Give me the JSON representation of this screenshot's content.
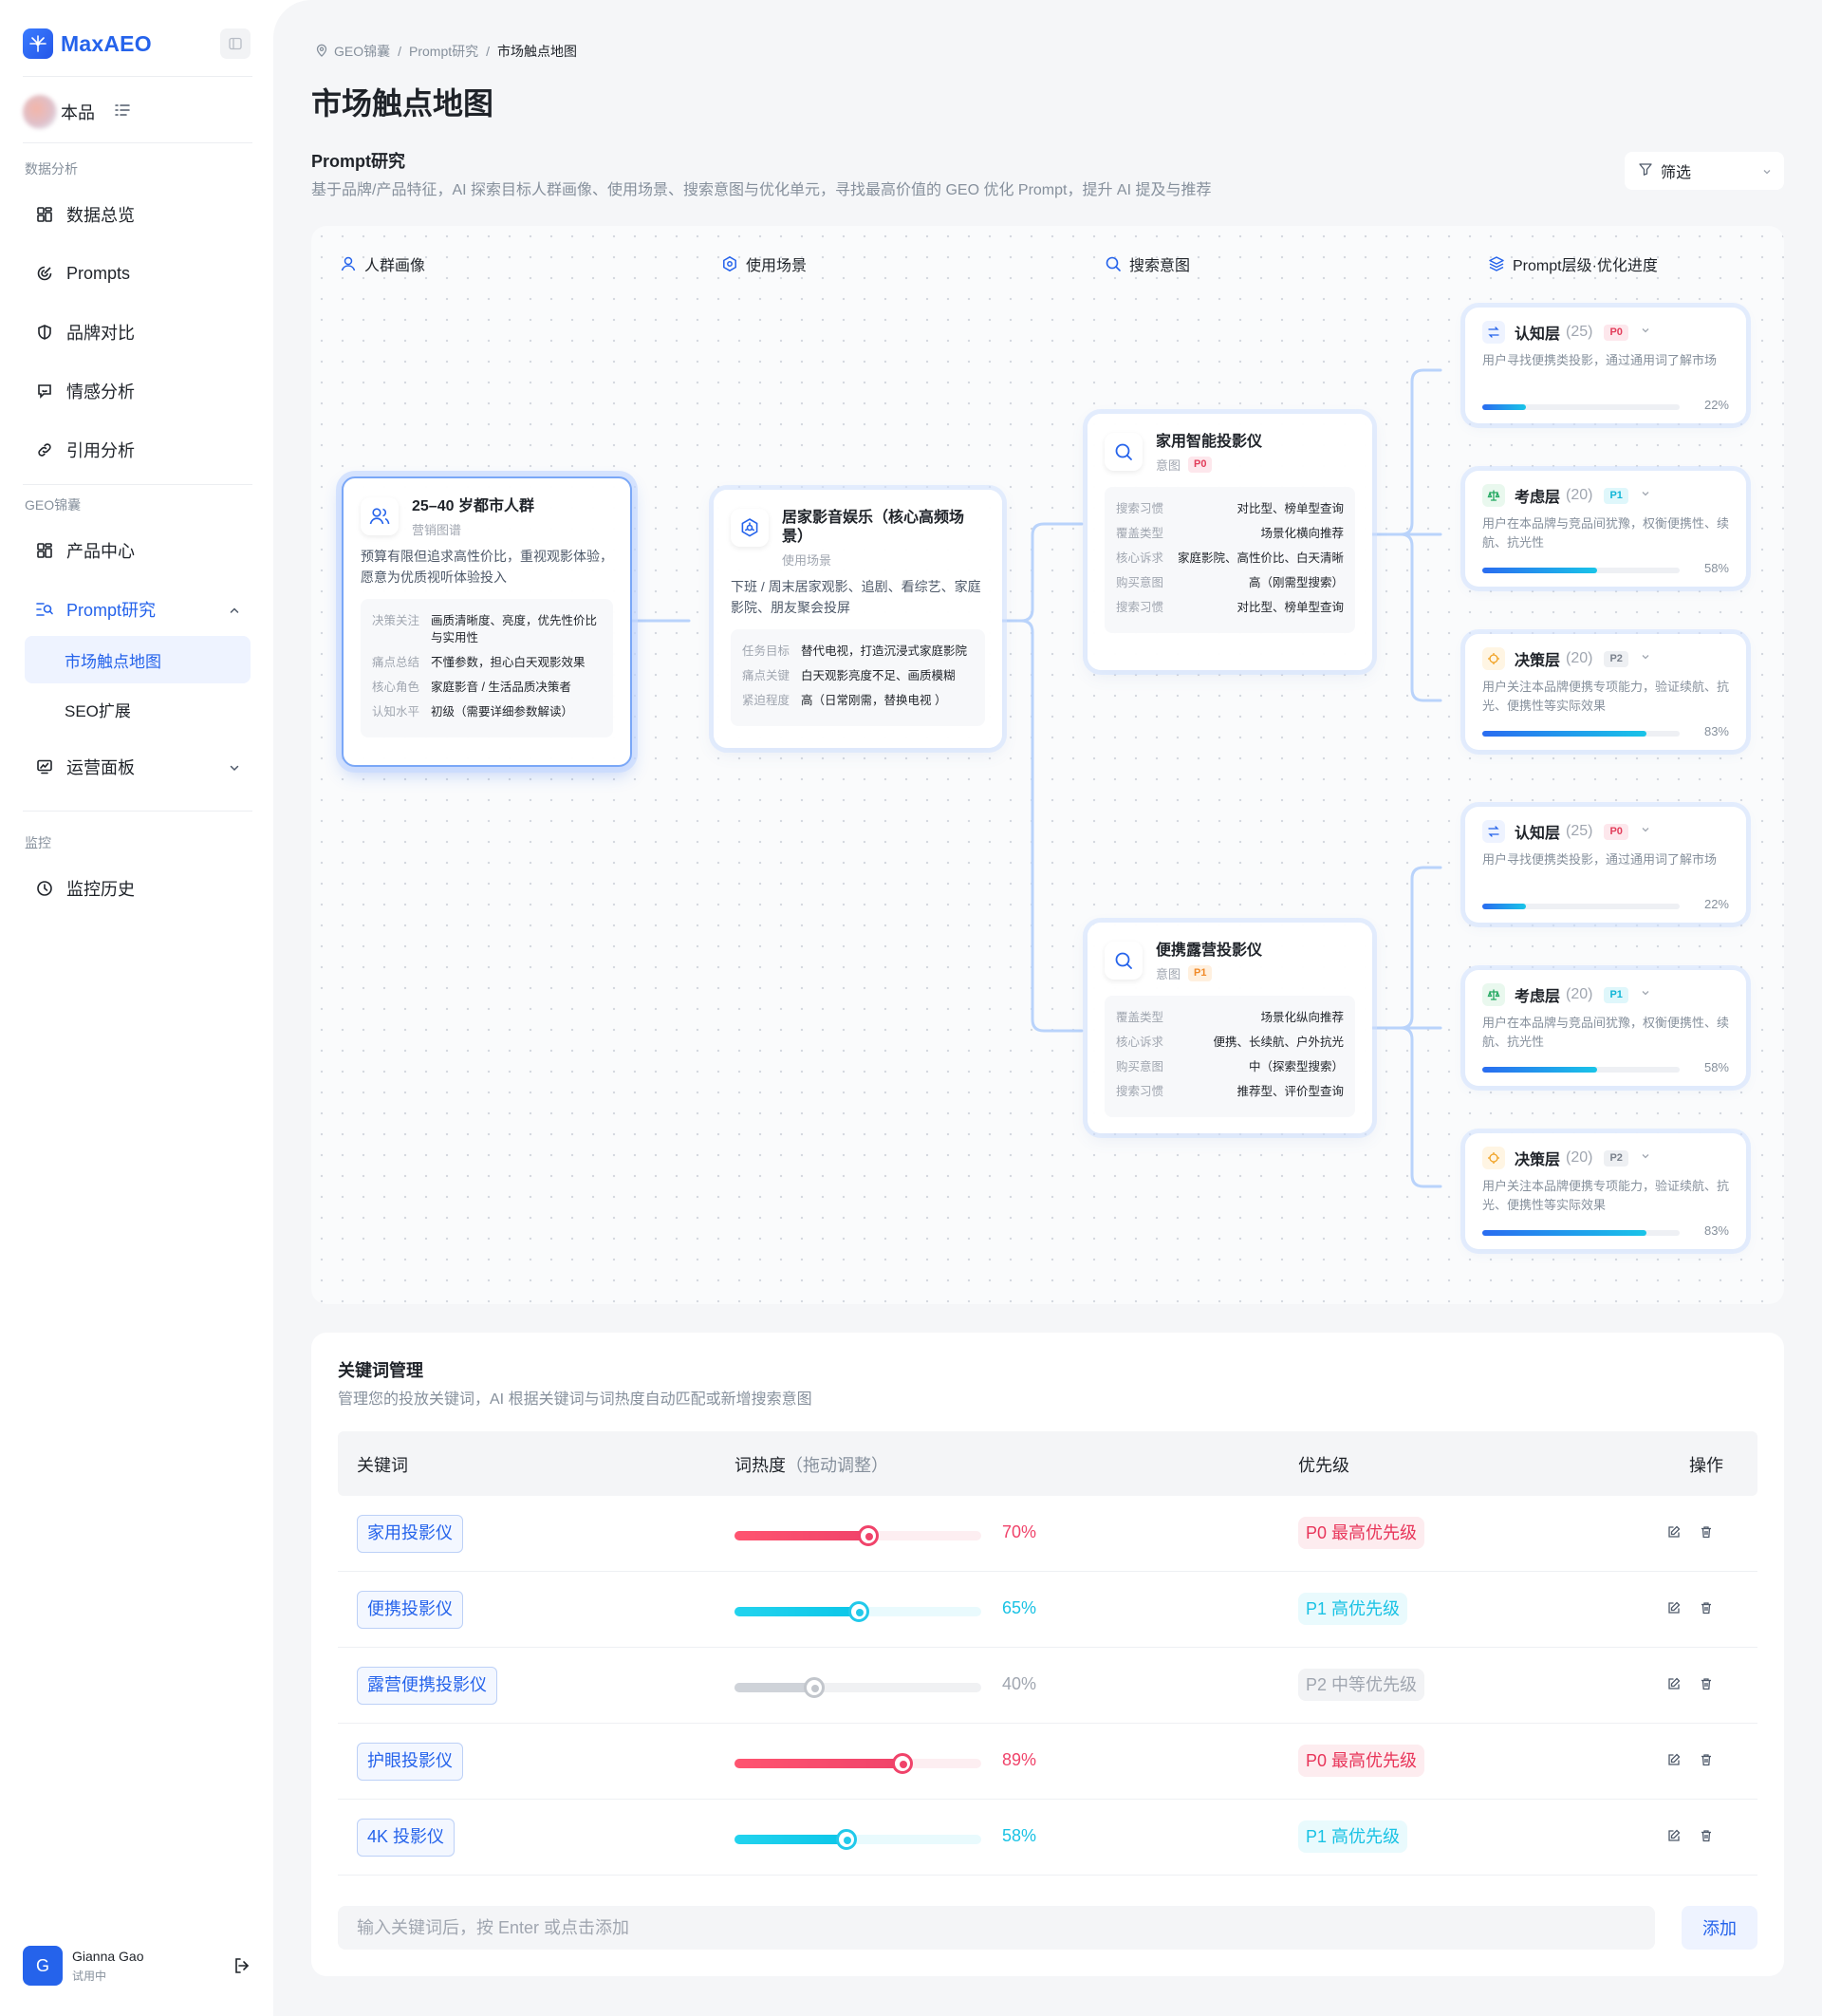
{
  "app": {
    "name": "MaxAEO"
  },
  "brand": {
    "name": "本品"
  },
  "sidebar": {
    "group_analysis": "数据分析",
    "group_geo": "GEO锦囊",
    "group_monitor": "监控",
    "items": {
      "overview": "数据总览",
      "prompts": "Prompts",
      "brand_compare": "品牌对比",
      "sentiment": "情感分析",
      "citation": "引用分析",
      "product_center": "产品中心",
      "prompt_research": "Prompt研究",
      "touchpoint_map": "市场触点地图",
      "seo_ext": "SEO扩展",
      "ops_panel": "运营面板",
      "monitor_history": "监控历史"
    }
  },
  "user": {
    "initial": "G",
    "name": "Gianna Gao",
    "status": "试用中"
  },
  "breadcrumb": [
    "GEO锦囊",
    "Prompt研究",
    "市场触点地图"
  ],
  "page_title": "市场触点地图",
  "section": {
    "title": "Prompt研究",
    "desc": "基于品牌/产品特征，AI 探索目标人群画像、使用场景、搜索意图与优化单元，寻找最高价值的 GEO 优化 Prompt，提升 AI 提及与推荐"
  },
  "filter": {
    "label": "筛选"
  },
  "columns": [
    "人群画像",
    "使用场景",
    "搜索意图",
    "Prompt层级·优化进度"
  ],
  "persona": {
    "title": "25–40 岁都市人群",
    "sub": "营销图谱",
    "desc": "预算有限但追求高性价比，重视观影体验，愿意为优质视听体验投入",
    "kv": [
      {
        "k": "决策关注",
        "v": "画质清晰度、亮度，优先性价比与实用性"
      },
      {
        "k": "痛点总结",
        "v": "不懂参数，担心白天观影效果"
      },
      {
        "k": "核心角色",
        "v": "家庭影音 / 生活品质决策者"
      },
      {
        "k": "认知水平",
        "v": "初级（需要详细参数解读）"
      }
    ]
  },
  "scene": {
    "title": "居家影音娱乐（核心高频场景）",
    "sub": "使用场景",
    "desc": "下班 / 周末居家观影、追剧、看综艺、家庭影院、朋友聚会投屏",
    "kv": [
      {
        "k": "任务目标",
        "v": "替代电视，打造沉浸式家庭影院"
      },
      {
        "k": "痛点关键",
        "v": "白天观影亮度不足、画质模糊"
      },
      {
        "k": "紧迫程度",
        "v": "高（日常刚需，替换电视 ）"
      }
    ]
  },
  "intents": [
    {
      "title": "家用智能投影仪",
      "sub": "意图",
      "tag": "P0",
      "kv": [
        {
          "k": "搜索习惯",
          "v": "对比型、榜单型查询"
        },
        {
          "k": "覆盖类型",
          "v": "场景化横向推荐"
        },
        {
          "k": "核心诉求",
          "v": "家庭影院、高性价比、白天清晰"
        },
        {
          "k": "购买意图",
          "v": "高（刚需型搜索）"
        },
        {
          "k": "搜索习惯",
          "v": "对比型、榜单型查询"
        }
      ]
    },
    {
      "title": "便携露营投影仪",
      "sub": "意图",
      "tag": "P1",
      "kv": [
        {
          "k": "覆盖类型",
          "v": "场景化纵向推荐"
        },
        {
          "k": "核心诉求",
          "v": "便携、长续航、户外抗光"
        },
        {
          "k": "购买意图",
          "v": "中（探索型搜索）"
        },
        {
          "k": "搜索习惯",
          "v": "推荐型、评价型查询"
        }
      ]
    }
  ],
  "layers": [
    {
      "name": "认知层",
      "count": "(25)",
      "tag": "P0",
      "desc": "用户寻找便携类投影，通过通用词了解市场",
      "progress": 0.22,
      "pct": "22%"
    },
    {
      "name": "考虑层",
      "count": "(20)",
      "tag": "P1",
      "desc": "用户在本品牌与竞品间犹豫，权衡便携性、续航、抗光性",
      "progress": 0.58,
      "pct": "58%"
    },
    {
      "name": "决策层",
      "count": "(20)",
      "tag": "P2",
      "desc": "用户关注本品牌便携专项能力，验证续航、抗光、便携性等实际效果",
      "progress": 0.83,
      "pct": "83%"
    },
    {
      "name": "认知层",
      "count": "(25)",
      "tag": "P0",
      "desc": "用户寻找便携类投影，通过通用词了解市场",
      "progress": 0.22,
      "pct": "22%"
    },
    {
      "name": "考虑层",
      "count": "(20)",
      "tag": "P1",
      "desc": "用户在本品牌与竞品间犹豫，权衡便携性、续航、抗光性",
      "progress": 0.58,
      "pct": "58%"
    },
    {
      "name": "决策层",
      "count": "(20)",
      "tag": "P2",
      "desc": "用户关注本品牌便携专项能力，验证续航、抗光、便携性等实际效果",
      "progress": 0.83,
      "pct": "83%"
    }
  ],
  "keywords": {
    "title": "关键词管理",
    "desc": "管理您的投放关键词，AI 根据关键词与词热度自动匹配或新增搜索意图",
    "headers": {
      "keyword": "关键词",
      "heat": "词热度",
      "heat_hint": "（拖动调整）",
      "priority": "优先级",
      "actions": "操作"
    },
    "rows": [
      {
        "keyword": "家用投影仪",
        "heat": 0.7,
        "pct": "70%",
        "priority": "P0 最高优先级",
        "color": "#f0436a"
      },
      {
        "keyword": "便携投影仪",
        "heat": 0.65,
        "pct": "65%",
        "priority": "P1 高优先级",
        "color": "#19c2e4"
      },
      {
        "keyword": "露营便携投影仪",
        "heat": 0.4,
        "pct": "40%",
        "priority": "P2 中等优先级",
        "color": "#a0a6b0"
      },
      {
        "keyword": "护眼投影仪",
        "heat": 0.89,
        "pct": "89%",
        "priority": "P0 最高优先级",
        "color": "#f0436a"
      },
      {
        "keyword": "4K 投影仪",
        "heat": 0.58,
        "pct": "58%",
        "priority": "P1 高优先级",
        "color": "#19c2e4"
      }
    ],
    "input_placeholder": "输入关键词后，按 Enter 或点击添加",
    "add_label": "添加"
  },
  "colors": {
    "accent": "#2563eb",
    "p0": "#f0436a",
    "p1": "#19c2e4",
    "p2": "#a0a6b0"
  }
}
